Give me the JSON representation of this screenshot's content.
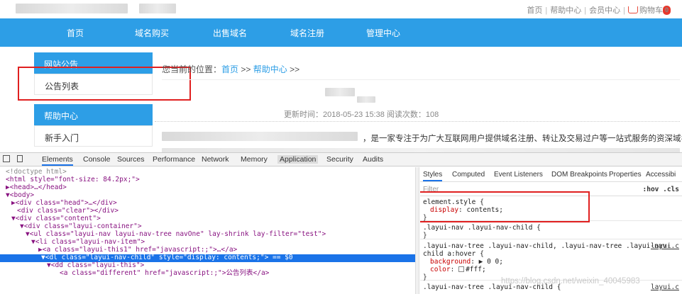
{
  "top_links": {
    "home": "首页",
    "help": "帮助中心",
    "member": "会员中心",
    "cart": "购物车",
    "cart_count": "0",
    "sep": "|"
  },
  "nav": [
    "首页",
    "域名购买",
    "出售域名",
    "域名注册",
    "管理中心"
  ],
  "sidebar": {
    "section1": "网站公告",
    "item1": "公告列表",
    "section2": "帮助中心",
    "item2": "新手入门"
  },
  "breadcrumb": {
    "prefix": "您当前的位置：",
    "home": "首页",
    "sep1": " >> ",
    "help": "帮助中心",
    "sep2": " >>"
  },
  "article": {
    "meta": "更新时间：2018-05-23 15:38 阅读次数：108",
    "text": "，是一家专注于为广大互联网用户提供域名注册、转让及交易过户等一站式服务的资深域名"
  },
  "devtools": {
    "tabs": [
      "Elements",
      "Console",
      "Sources",
      "Performance",
      "Network",
      "Memory",
      "Application",
      "Security",
      "Audits"
    ],
    "dom": [
      "<!doctype html>",
      "<html style=\"font-size: 84.2px;\">",
      "▶<head>…</head>",
      "▼<body>",
      "▶<div class=\"head\">…</div>",
      "<div class=\"clear\"></div>",
      "▼<div class=\"content\">",
      "▼<div class=\"layui-container\">",
      "▼<ul class=\"layui-nav layui-nav-tree navOne\" lay-shrink lay-filter=\"test\">",
      "▼<li class=\"layui-nav-item\">",
      "▶<a class=\"layui-this1\" href=\"javascript:;\">…</a>",
      "▼<dl class=\"layui-nav-child\" style=\"display: contents;\"> == $0",
      "▼<dd class=\"layui-this\">",
      "<a class=\"different\" href=\"javascript:;\">公告列表</a>"
    ],
    "styles_tabs": [
      "Styles",
      "Computed",
      "Event Listeners",
      "DOM Breakpoints",
      "Properties",
      "Accessibi"
    ],
    "filter_placeholder": "Filter",
    "filter_hov": ":hov  .cls",
    "rules": {
      "r1_sel": "element.style {",
      "r1_prop": "display",
      "r1_val": "contents;",
      "r2_sel": ".layui-nav .layui-nav-child {",
      "r3_sel": ".layui-nav-tree .layui-nav-child, .layui-nav-tree .layui-nav-",
      "r3_sel2": "child a:hover {",
      "r3_src": "layui.c",
      "r3_prop1": "background",
      "r3_val1": "▶ 0 0;",
      "r3_prop2": "color",
      "r3_val2": "#fff;",
      "r4_sel": ".layui-nav-tree .layui-nav-child {",
      "r4_src": "layui.c",
      "close": "}"
    },
    "watermark": "https://blog.csdn.net/weixin_40045983"
  }
}
